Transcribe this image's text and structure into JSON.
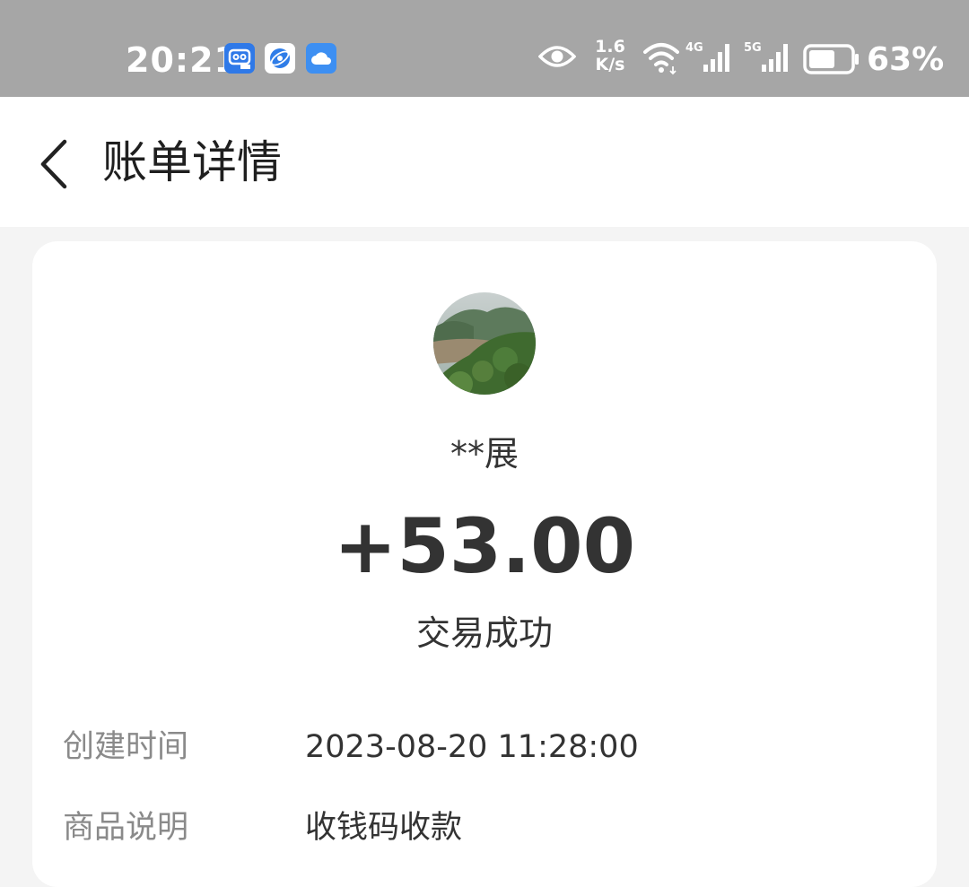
{
  "status_bar": {
    "time": "20:21",
    "apps": [
      "messaging-app-icon",
      "browser-app-icon",
      "cloud-app-icon"
    ],
    "net_speed_value": "1.6",
    "net_speed_unit": "K/s",
    "network_1": "4G",
    "network_2": "5G",
    "battery_percent": "63%",
    "battery_level": 0.63
  },
  "header": {
    "title": "账单详情"
  },
  "bill": {
    "payer_name": "**展",
    "amount": "+53.00",
    "status": "交易成功",
    "details": [
      {
        "label": "创建时间",
        "value": "2023-08-20 11:28:00"
      },
      {
        "label": "商品说明",
        "value": "收钱码收款"
      }
    ]
  },
  "colors": {
    "status_bar_bg": "#a6a6a6",
    "page_bg": "#f4f4f4",
    "card_bg": "#ffffff",
    "primary_text": "#333333",
    "secondary_text": "#8a8a8a"
  }
}
